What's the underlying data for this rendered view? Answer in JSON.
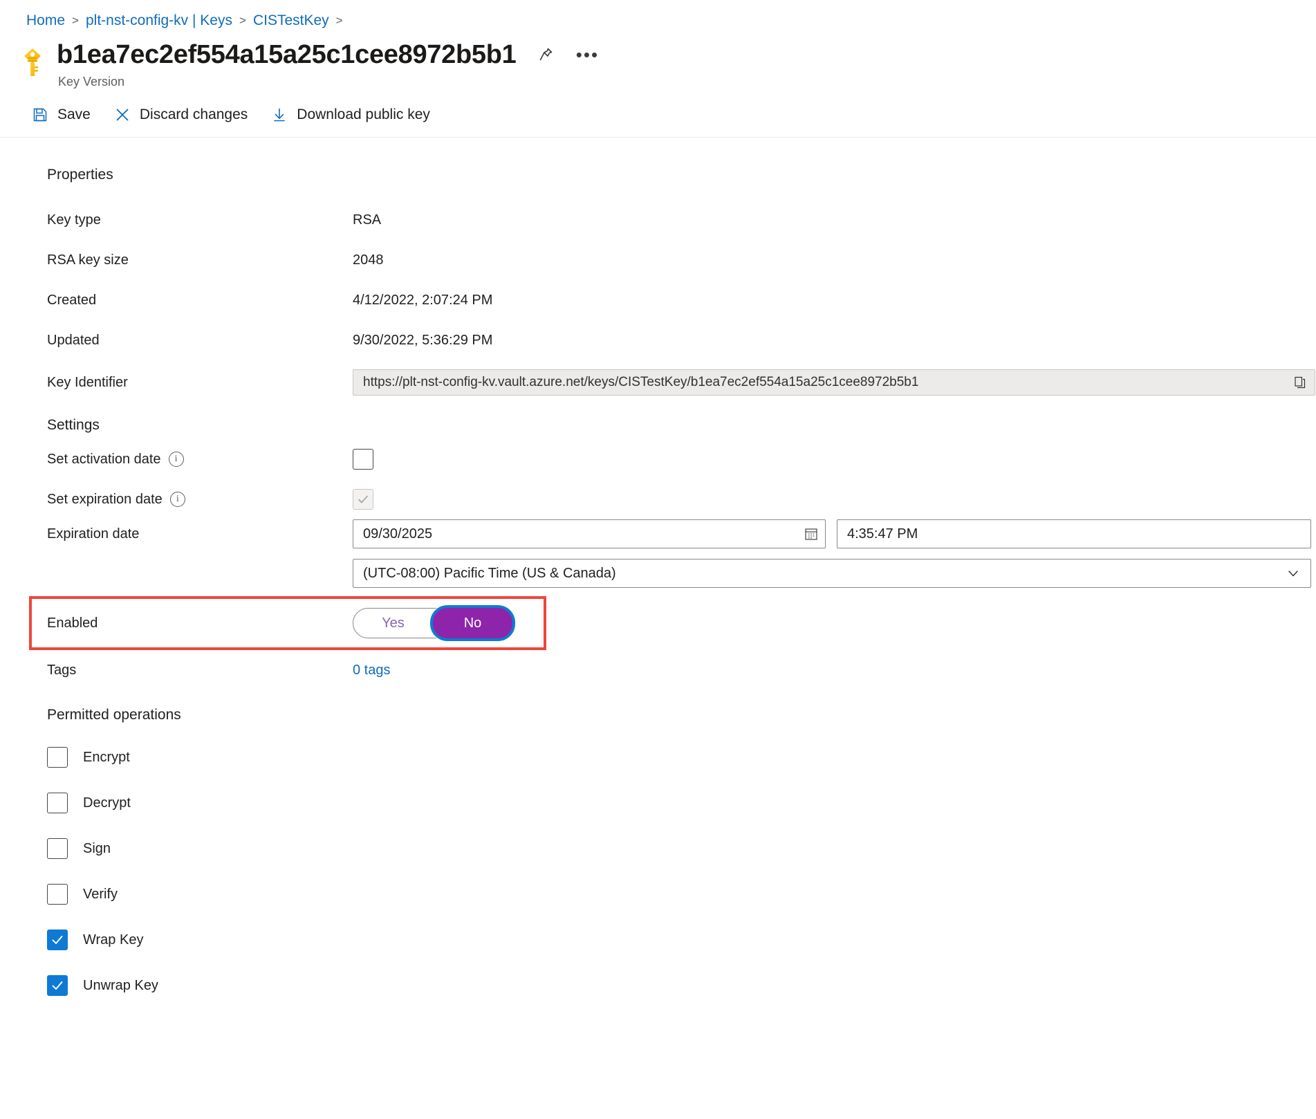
{
  "breadcrumb": {
    "items": [
      {
        "label": "Home"
      },
      {
        "label": "plt-nst-config-kv | Keys"
      },
      {
        "label": "CISTestKey"
      }
    ],
    "separator": ">"
  },
  "header": {
    "icon": "key-icon",
    "title": "b1ea7ec2ef554a15a25c1cee8972b5b1",
    "subtitle": "Key Version",
    "pin_icon": "pin-icon",
    "more_icon": "ellipsis-icon",
    "more_label": "•••"
  },
  "toolbar": {
    "buttons": [
      {
        "label": "Save",
        "icon": "save-icon"
      },
      {
        "label": "Discard changes",
        "icon": "close-x-icon"
      },
      {
        "label": "Download public key",
        "icon": "download-arrow-icon"
      }
    ]
  },
  "properties": {
    "heading": "Properties",
    "key_type": {
      "label": "Key type",
      "value": "RSA"
    },
    "rsa_key_size": {
      "label": "RSA key size",
      "value": "2048"
    },
    "created": {
      "label": "Created",
      "value": "4/12/2022, 2:07:24 PM"
    },
    "updated": {
      "label": "Updated",
      "value": "9/30/2022, 5:36:29 PM"
    },
    "key_identifier": {
      "label": "Key Identifier",
      "value": "https://plt-nst-config-kv.vault.azure.net/keys/CISTestKey/b1ea7ec2ef554a15a25c1cee8972b5b1",
      "copy_icon": "copy-icon"
    }
  },
  "settings": {
    "heading": "Settings",
    "set_activation_date": {
      "label": "Set activation date",
      "info_icon": "info-icon",
      "info_glyph": "i",
      "checked": false
    },
    "set_expiration_date": {
      "label": "Set expiration date",
      "info_icon": "info-icon",
      "info_glyph": "i",
      "checked": true,
      "disabled": true
    },
    "expiration_date": {
      "label": "Expiration date",
      "date_value": "09/30/2025",
      "time_value": "4:35:47 PM",
      "calendar_icon": "calendar-icon",
      "timezone_value": "(UTC-08:00) Pacific Time (US & Canada)",
      "chevron_icon": "chevron-down-icon"
    },
    "enabled": {
      "label": "Enabled",
      "option_yes": "Yes",
      "option_no": "No",
      "selected": "No",
      "highlight_color": "#f0453a",
      "selected_color": "#8e24aa",
      "focus_color": "#0f7ad3",
      "unselected_text_color": "#8764b8"
    },
    "tags": {
      "label": "Tags",
      "value": "0 tags"
    }
  },
  "permitted_operations": {
    "heading": "Permitted operations",
    "items": [
      {
        "label": "Encrypt",
        "checked": false
      },
      {
        "label": "Decrypt",
        "checked": false
      },
      {
        "label": "Sign",
        "checked": false
      },
      {
        "label": "Verify",
        "checked": false
      },
      {
        "label": "Wrap Key",
        "checked": true
      },
      {
        "label": "Unwrap Key",
        "checked": true
      }
    ]
  },
  "colors": {
    "link": "#0f6cbd",
    "accent": "#0f7ad3",
    "text": "#201f1e",
    "muted": "#605e5c",
    "field_border": "#8a8886",
    "readonly_bg": "#edebe9"
  }
}
